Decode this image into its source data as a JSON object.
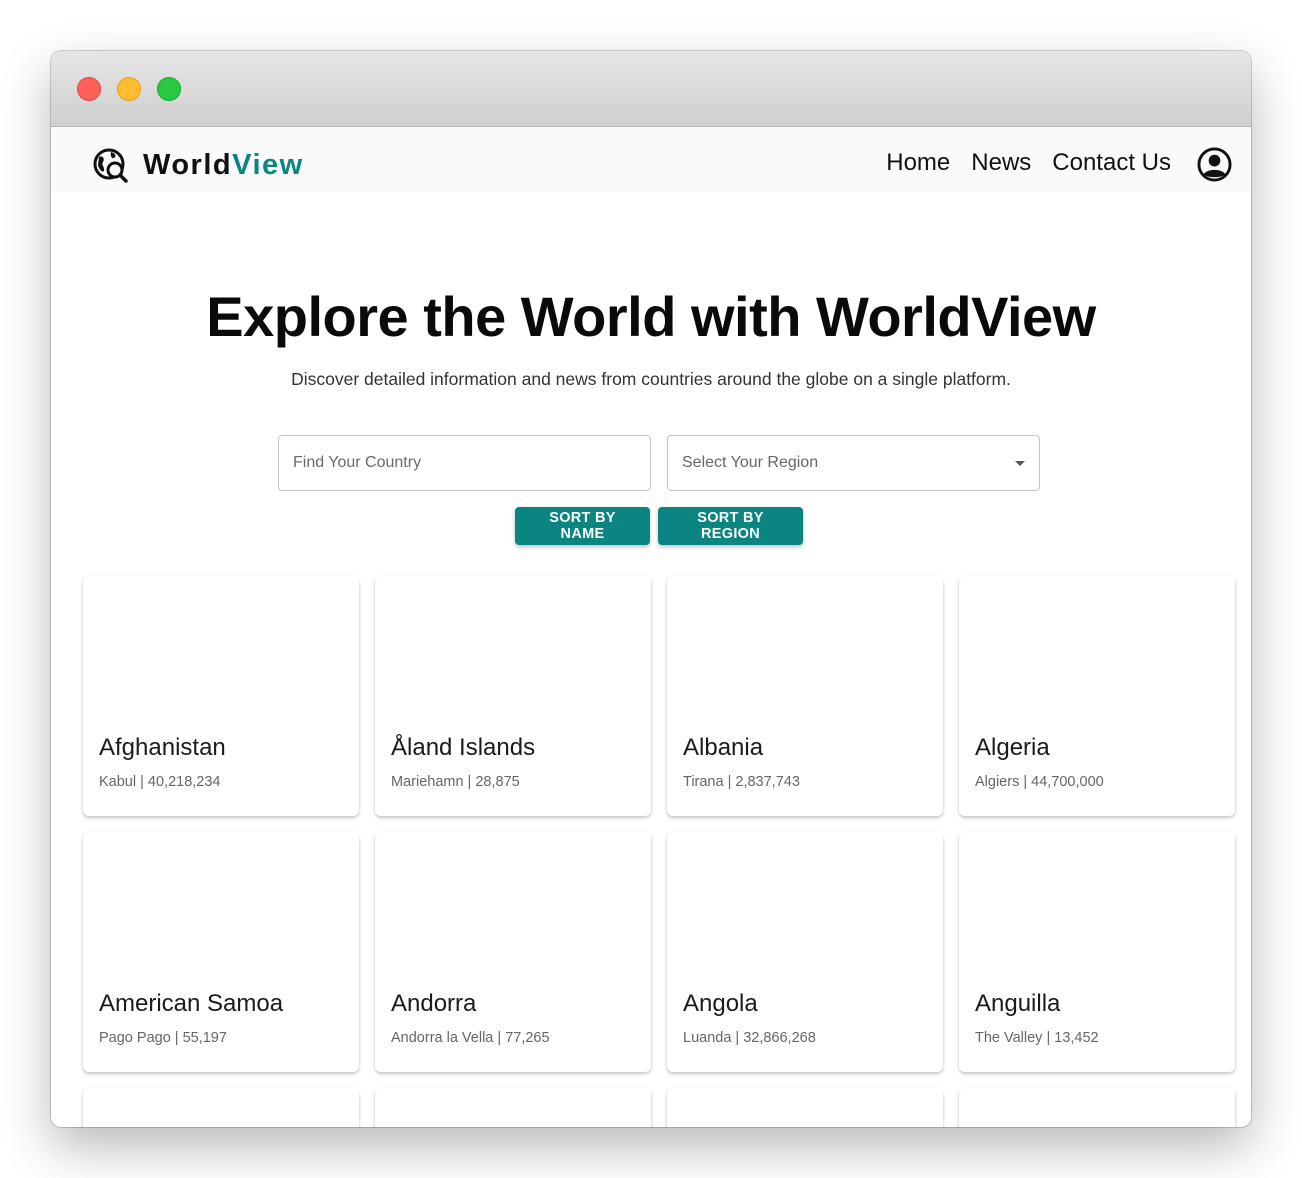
{
  "brand": {
    "name_part1": "World",
    "name_part2": "View",
    "accent_color": "#0b8582",
    "icon": "globe-search-icon"
  },
  "nav": {
    "links": [
      "Home",
      "News",
      "Contact Us"
    ],
    "account_icon": "account-circle-icon"
  },
  "hero": {
    "title": "Explore the World with WorldView",
    "subtitle": "Discover detailed information and news from countries around the globe on a single platform."
  },
  "search": {
    "placeholder": "Find Your Country",
    "value": ""
  },
  "region_select": {
    "placeholder": "Select Your Region"
  },
  "sort": {
    "by_name": "SORT BY NAME",
    "by_region": "SORT BY REGION"
  },
  "countries": [
    {
      "name": "Afghanistan",
      "meta": "Kabul | 40,218,234"
    },
    {
      "name": "Åland Islands",
      "meta": "Mariehamn | 28,875"
    },
    {
      "name": "Albania",
      "meta": "Tirana | 2,837,743"
    },
    {
      "name": "Algeria",
      "meta": "Algiers | 44,700,000"
    },
    {
      "name": "American Samoa",
      "meta": "Pago Pago | 55,197"
    },
    {
      "name": "Andorra",
      "meta": "Andorra la Vella | 77,265"
    },
    {
      "name": "Angola",
      "meta": "Luanda | 32,866,268"
    },
    {
      "name": "Anguilla",
      "meta": "The Valley | 13,452"
    }
  ]
}
